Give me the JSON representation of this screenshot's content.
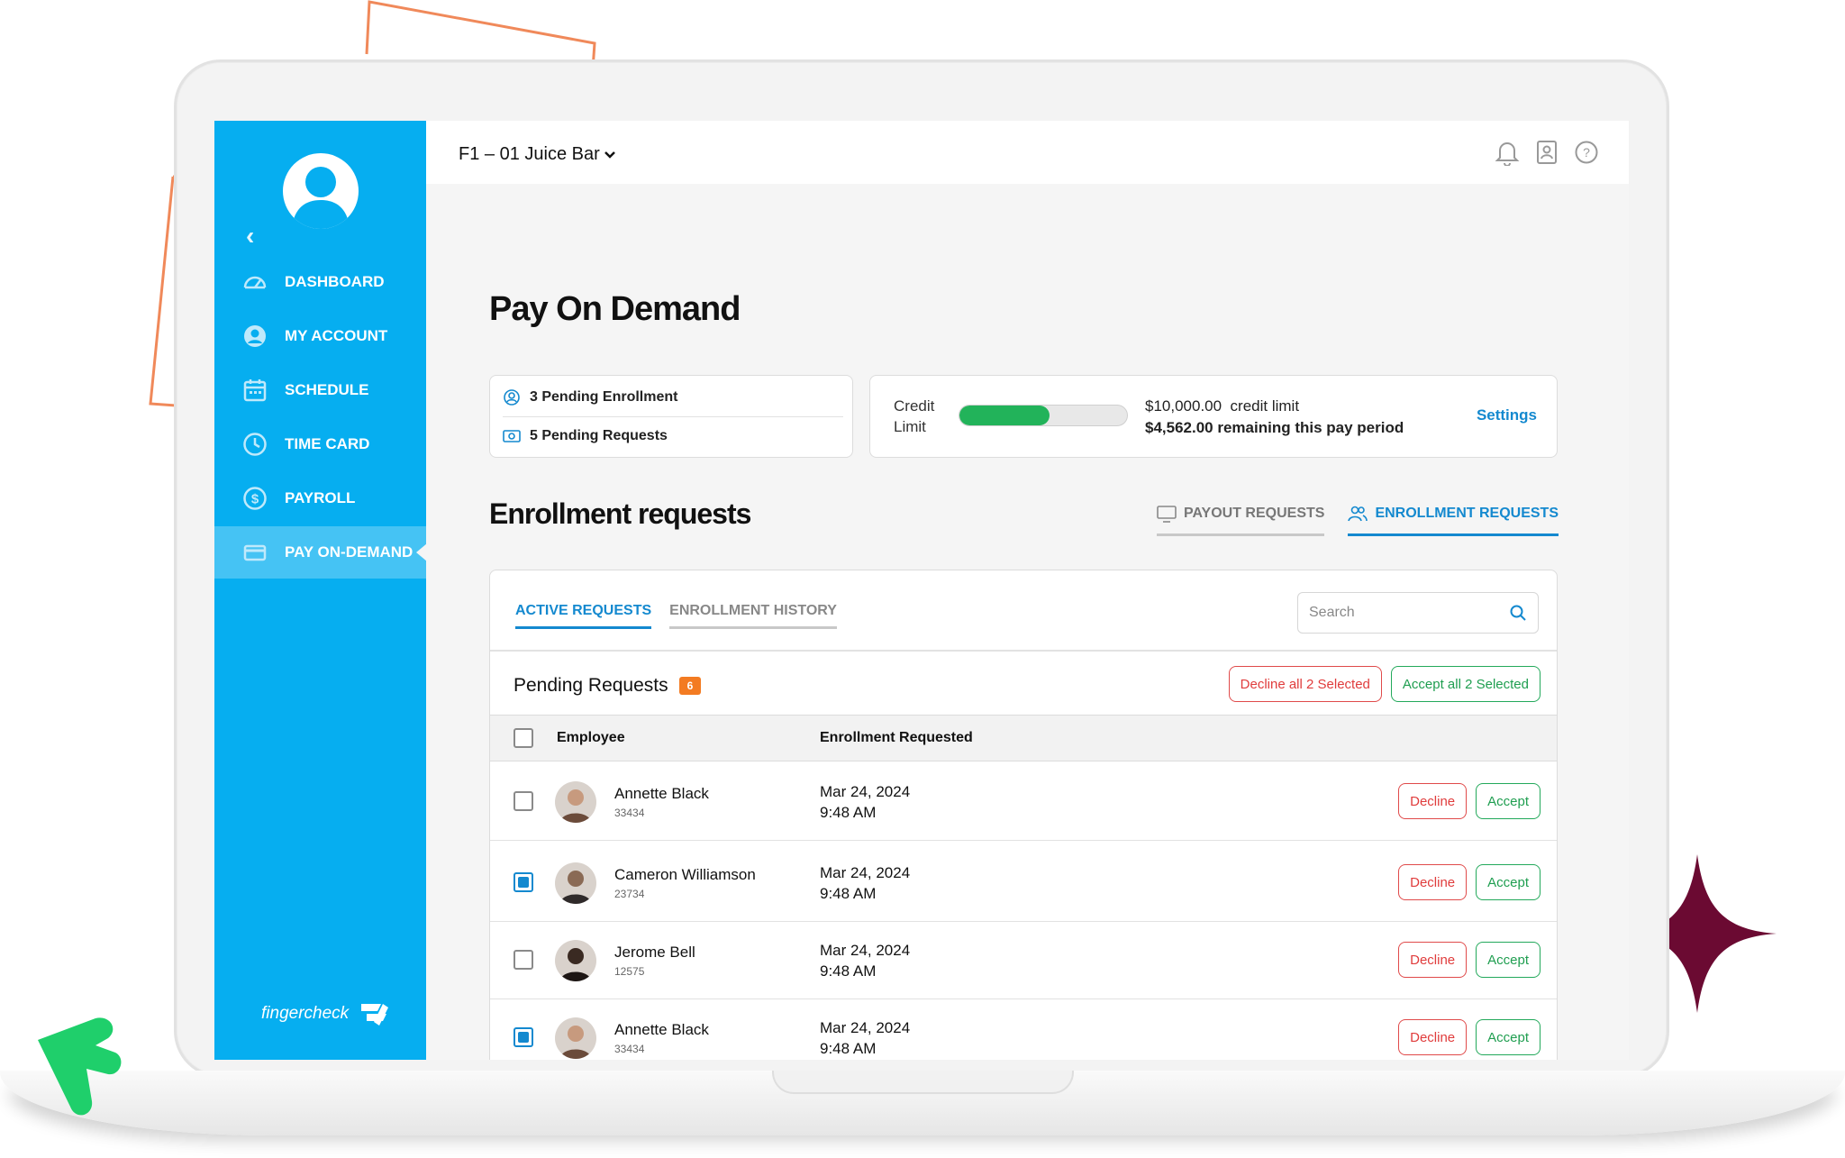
{
  "app": {
    "location": "F1 – 01 Juice Bar",
    "brand": "fingercheck"
  },
  "sidebar": {
    "items": [
      {
        "label": "DASHBOARD",
        "icon": "speedometer-icon"
      },
      {
        "label": "MY ACCOUNT",
        "icon": "user-circle-icon"
      },
      {
        "label": "SCHEDULE",
        "icon": "calendar-icon"
      },
      {
        "label": "TIME CARD",
        "icon": "clock-icon"
      },
      {
        "label": "PAYROLL",
        "icon": "dollar-icon"
      },
      {
        "label": "PAY ON-DEMAND",
        "icon": "card-icon",
        "active": true
      }
    ]
  },
  "page": {
    "title": "Pay On Demand"
  },
  "summary": {
    "pending_enrollment": "3 Pending Enrollment",
    "pending_requests": "5 Pending Requests"
  },
  "credit": {
    "label_line1": "Credit",
    "label_line2": "Limit",
    "used_fraction": 0.54,
    "limit_amount": "$10,000.00",
    "limit_suffix": "credit limit",
    "remaining_text": "$4,562.00 remaining this pay period",
    "settings_label": "Settings"
  },
  "section": {
    "title": "Enrollment requests",
    "tabs": [
      {
        "label": "PAYOUT REQUESTS",
        "active": false
      },
      {
        "label": "ENROLLMENT REQUESTS",
        "active": true
      }
    ]
  },
  "requests": {
    "sub_tabs": [
      {
        "label": "ACTIVE REQUESTS",
        "active": true
      },
      {
        "label": "ENROLLMENT HISTORY",
        "active": false
      }
    ],
    "search_placeholder": "Search",
    "pending_title": "Pending Requests",
    "pending_count": "6",
    "decline_all_label": "Decline all 2 Selected",
    "accept_all_label": "Accept all 2 Selected",
    "columns": [
      "Employee",
      "Enrollment Requested"
    ],
    "rows": [
      {
        "name": "Annette Black",
        "id": "33434",
        "date": "Mar 24, 2024",
        "time": "9:48 AM",
        "checked": false
      },
      {
        "name": "Cameron Williamson",
        "id": "23734",
        "date": "Mar 24, 2024",
        "time": "9:48 AM",
        "checked": true
      },
      {
        "name": "Jerome Bell",
        "id": "12575",
        "date": "Mar 24, 2024",
        "time": "9:48 AM",
        "checked": false
      },
      {
        "name": "Annette Black",
        "id": "33434",
        "date": "Mar 24, 2024",
        "time": "9:48 AM",
        "checked": true
      }
    ],
    "decline_label": "Decline",
    "accept_label": "Accept"
  },
  "colors": {
    "sidebar": "#06aef0",
    "accent": "#1489cf",
    "decline": "#e03c3c",
    "accept": "#1f9e50",
    "badge": "#f37b22",
    "progress": "#22b35a"
  }
}
